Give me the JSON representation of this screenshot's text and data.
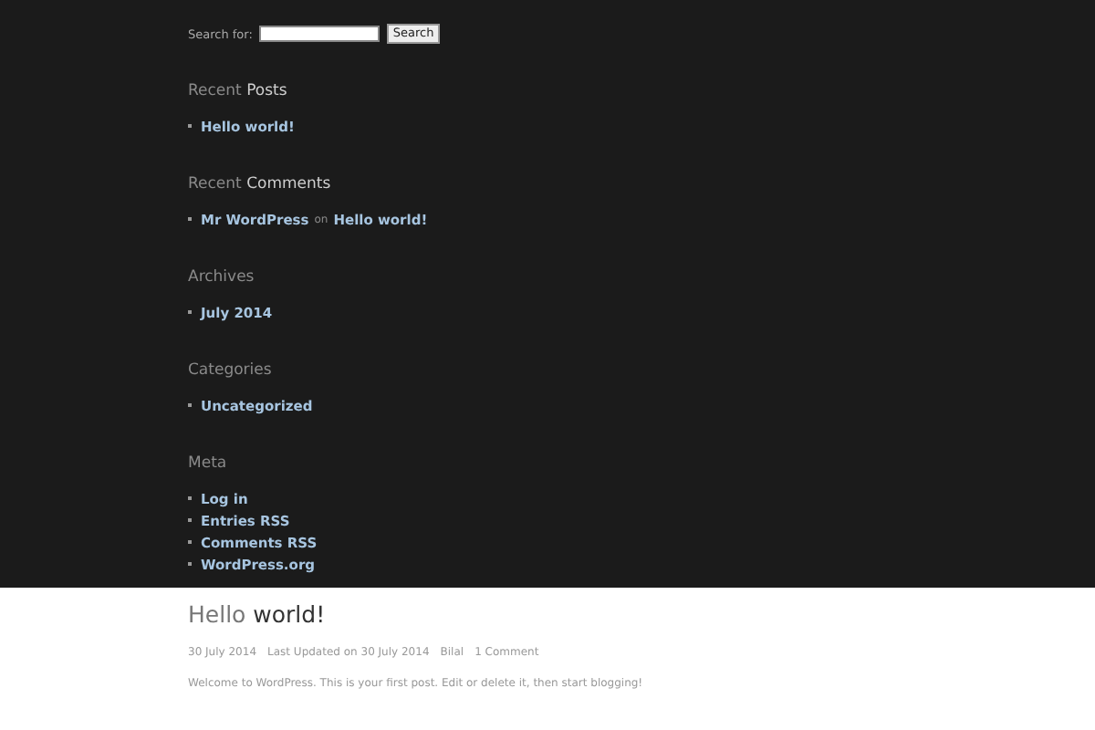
{
  "search": {
    "label": "Search for:",
    "button": "Search"
  },
  "widgets": [
    {
      "heading": {
        "lead": "Recent",
        "main": "Posts"
      },
      "items": [
        {
          "kind": "link",
          "text": "Hello world!"
        }
      ]
    },
    {
      "heading": {
        "lead": "Recent",
        "main": "Comments"
      },
      "items": [
        {
          "kind": "comment",
          "author": "Mr WordPress",
          "joiner": "on",
          "post": "Hello world!"
        }
      ]
    },
    {
      "heading": {
        "lead": "Archives"
      },
      "items": [
        {
          "kind": "link",
          "text": "July 2014"
        }
      ]
    },
    {
      "heading": {
        "lead": "Categories"
      },
      "items": [
        {
          "kind": "link",
          "text": "Uncategorized"
        }
      ]
    },
    {
      "heading": {
        "lead": "Meta"
      },
      "items": [
        {
          "kind": "link",
          "text": "Log in"
        },
        {
          "kind": "link",
          "text": "Entries RSS"
        },
        {
          "kind": "link",
          "text": "Comments RSS"
        },
        {
          "kind": "link",
          "text": "WordPress.org"
        }
      ]
    }
  ],
  "post": {
    "title": {
      "lead": "Hello",
      "main": "world!"
    },
    "meta": [
      "30 July 2014",
      "Last Updated on 30 July 2014",
      "Bilal",
      "1 Comment"
    ],
    "excerpt": "Welcome to WordPress. This is your first post. Edit or delete it, then start blogging!"
  }
}
